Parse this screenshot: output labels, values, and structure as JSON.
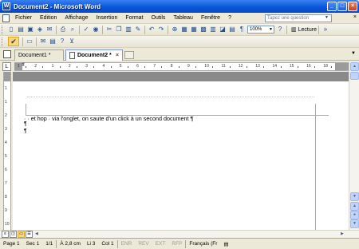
{
  "window": {
    "title": "Document2 - Microsoft Word",
    "icon": "word-icon",
    "controls": {
      "minimize": "_",
      "maximize": "□",
      "close": "×"
    }
  },
  "menu": {
    "items": [
      "Fichier",
      "Edition",
      "Affichage",
      "Insertion",
      "Format",
      "Outils",
      "Tableau",
      "Fenêtre",
      "?"
    ],
    "help_placeholder": "Tapez une question",
    "mdi_close": "×"
  },
  "toolbar": {
    "zoom": "100%",
    "lecture_label": "Lecture"
  },
  "tabs": [
    {
      "label": "Document1 *",
      "active": false
    },
    {
      "label": "Document2 *",
      "active": true
    }
  ],
  "ruler": {
    "numbers": [
      "1",
      "2",
      "1",
      "2",
      "3",
      "4",
      "5",
      "6",
      "7",
      "8",
      "9",
      "10",
      "11",
      "12",
      "13",
      "14",
      "15",
      "16",
      "18"
    ]
  },
  "vruler": {
    "numbers": [
      "1",
      "1",
      "2",
      "3",
      "4",
      "5",
      "6",
      "7",
      "8",
      "9",
      "10"
    ]
  },
  "document": {
    "line1": "· · et hop · via l'onglet, on saute d'un click à un second document ¶",
    "para1": "¶",
    "para2": "¶"
  },
  "status": {
    "page": "Page  1",
    "sec": "Sec  1",
    "pages": "1/1",
    "at": "À  2,8 cm",
    "line": "Li  3",
    "col": "Col  1",
    "enr": "ENR",
    "rev": "REV",
    "ext": "EXT",
    "rfp": "RFP",
    "lang": "Français (Fr"
  },
  "colors": {
    "titlebar": "#0a58d8",
    "active_tab_border": "#7a96df",
    "highlight_button": "#f9d77f"
  }
}
